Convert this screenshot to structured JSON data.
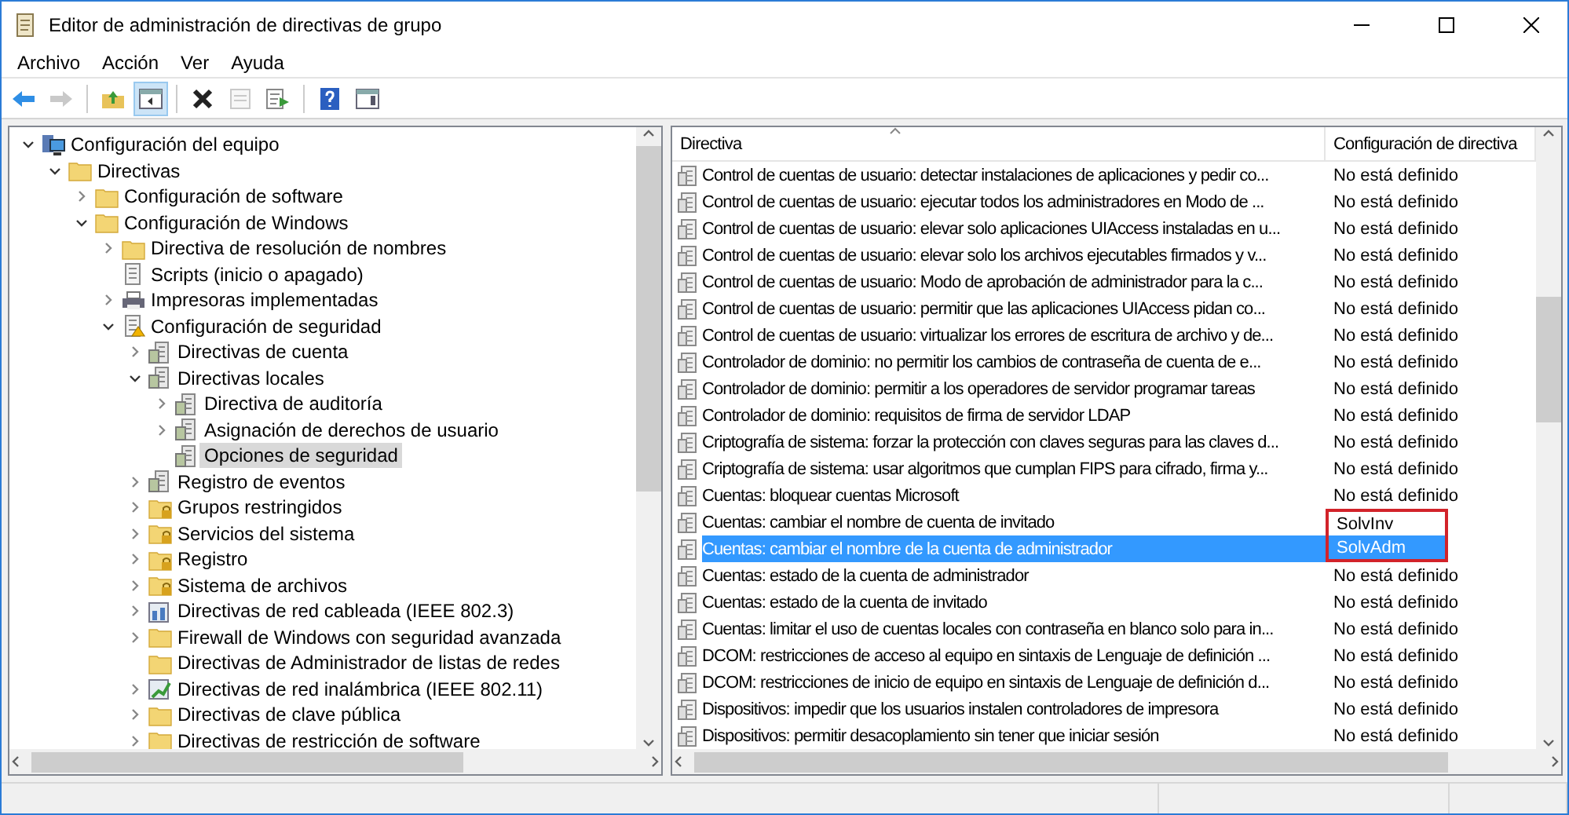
{
  "window": {
    "title": "Editor de administración de directivas de grupo"
  },
  "menu": [
    "Archivo",
    "Acción",
    "Ver",
    "Ayuda"
  ],
  "toolbar": [
    {
      "kind": "back",
      "disabled": false,
      "pressed": false
    },
    {
      "kind": "forward",
      "disabled": true,
      "pressed": false
    },
    {
      "kind": "sep"
    },
    {
      "kind": "up",
      "disabled": false,
      "pressed": false
    },
    {
      "kind": "tree",
      "disabled": false,
      "pressed": true
    },
    {
      "kind": "sep"
    },
    {
      "kind": "delete",
      "disabled": false,
      "pressed": false
    },
    {
      "kind": "properties",
      "disabled": true,
      "pressed": false
    },
    {
      "kind": "export",
      "disabled": false,
      "pressed": false
    },
    {
      "kind": "sep"
    },
    {
      "kind": "help",
      "disabled": false,
      "pressed": false
    },
    {
      "kind": "view",
      "disabled": false,
      "pressed": false
    }
  ],
  "tree": [
    {
      "label": "Configuración del equipo",
      "kind": "computer",
      "expanded": true,
      "selected": false,
      "children": [
        {
          "label": "Directivas",
          "kind": "folder",
          "expanded": true,
          "selected": false,
          "children": [
            {
              "label": "Configuración de software",
              "kind": "folder",
              "expanded": false,
              "selected": false
            },
            {
              "label": "Configuración de Windows",
              "kind": "folder",
              "expanded": true,
              "selected": false,
              "children": [
                {
                  "label": "Directiva de resolución de nombres",
                  "kind": "folder",
                  "expanded": false,
                  "selected": false
                },
                {
                  "label": "Scripts (inicio o apagado)",
                  "kind": "script",
                  "selected": false
                },
                {
                  "label": "Impresoras implementadas",
                  "kind": "printer",
                  "expanded": false,
                  "selected": false
                },
                {
                  "label": "Configuración de seguridad",
                  "kind": "security",
                  "expanded": true,
                  "selected": false,
                  "children": [
                    {
                      "label": "Directivas de cuenta",
                      "kind": "policy",
                      "expanded": false,
                      "selected": false
                    },
                    {
                      "label": "Directivas locales",
                      "kind": "policy",
                      "expanded": true,
                      "selected": false,
                      "children": [
                        {
                          "label": "Directiva de auditoría",
                          "kind": "policy",
                          "expanded": false,
                          "selected": false
                        },
                        {
                          "label": "Asignación de derechos de usuario",
                          "kind": "policy",
                          "expanded": false,
                          "selected": false
                        },
                        {
                          "label": "Opciones de seguridad",
                          "kind": "policy",
                          "selected": true
                        }
                      ]
                    },
                    {
                      "label": "Registro de eventos",
                      "kind": "policy",
                      "expanded": false,
                      "selected": false
                    },
                    {
                      "label": "Grupos restringidos",
                      "kind": "lockfolder",
                      "expanded": false,
                      "selected": false
                    },
                    {
                      "label": "Servicios del sistema",
                      "kind": "lockfolder",
                      "expanded": false,
                      "selected": false
                    },
                    {
                      "label": "Registro",
                      "kind": "lockfolder",
                      "expanded": false,
                      "selected": false
                    },
                    {
                      "label": "Sistema de archivos",
                      "kind": "lockfolder",
                      "expanded": false,
                      "selected": false
                    },
                    {
                      "label": "Directivas de red cableada (IEEE 802.3)",
                      "kind": "network",
                      "expanded": false,
                      "selected": false
                    },
                    {
                      "label": "Firewall de Windows con seguridad avanzada",
                      "kind": "folder",
                      "expanded": false,
                      "selected": false
                    },
                    {
                      "label": "Directivas de Administrador de listas de redes",
                      "kind": "folder",
                      "selected": false
                    },
                    {
                      "label": "Directivas de red inalámbrica (IEEE 802.11)",
                      "kind": "wireless",
                      "expanded": false,
                      "selected": false
                    },
                    {
                      "label": "Directivas de clave pública",
                      "kind": "folder",
                      "expanded": false,
                      "selected": false
                    },
                    {
                      "label": "Directivas de restricción de software",
                      "kind": "folder",
                      "expanded": false,
                      "selected": false
                    }
                  ]
                }
              ]
            }
          ]
        }
      ]
    }
  ],
  "table": {
    "columns": [
      "Directiva",
      "Configuración de directiva"
    ],
    "rows": [
      {
        "policy": "Control de cuentas de usuario: detectar instalaciones de aplicaciones y pedir co...",
        "setting": "No está definido",
        "selected": false,
        "highlighted": false
      },
      {
        "policy": "Control de cuentas de usuario: ejecutar todos los administradores en Modo de ...",
        "setting": "No está definido",
        "selected": false,
        "highlighted": false
      },
      {
        "policy": "Control de cuentas de usuario: elevar solo aplicaciones UIAccess instaladas en u...",
        "setting": "No está definido",
        "selected": false,
        "highlighted": false
      },
      {
        "policy": "Control de cuentas de usuario: elevar solo los archivos ejecutables firmados y v...",
        "setting": "No está definido",
        "selected": false,
        "highlighted": false
      },
      {
        "policy": "Control de cuentas de usuario: Modo de aprobación de administrador para la c...",
        "setting": "No está definido",
        "selected": false,
        "highlighted": false
      },
      {
        "policy": "Control de cuentas de usuario: permitir que las aplicaciones UIAccess pidan co...",
        "setting": "No está definido",
        "selected": false,
        "highlighted": false
      },
      {
        "policy": "Control de cuentas de usuario: virtualizar los errores de escritura de archivo y de...",
        "setting": "No está definido",
        "selected": false,
        "highlighted": false
      },
      {
        "policy": "Controlador de dominio: no permitir los cambios de contraseña de cuenta de e...",
        "setting": "No está definido",
        "selected": false,
        "highlighted": false
      },
      {
        "policy": "Controlador de dominio: permitir a los operadores de servidor programar tareas",
        "setting": "No está definido",
        "selected": false,
        "highlighted": false
      },
      {
        "policy": "Controlador de dominio: requisitos de firma de servidor LDAP",
        "setting": "No está definido",
        "selected": false,
        "highlighted": false
      },
      {
        "policy": "Criptografía de sistema: forzar la protección con claves seguras para las claves d...",
        "setting": "No está definido",
        "selected": false,
        "highlighted": false
      },
      {
        "policy": "Criptografía de sistema: usar algoritmos que cumplan FIPS para cifrado, firma y...",
        "setting": "No está definido",
        "selected": false,
        "highlighted": false
      },
      {
        "policy": "Cuentas: bloquear cuentas Microsoft",
        "setting": "No está definido",
        "selected": false,
        "highlighted": false
      },
      {
        "policy": "Cuentas: cambiar el nombre de cuenta de invitado",
        "setting": "SolvInv",
        "selected": false,
        "highlighted": true
      },
      {
        "policy": "Cuentas: cambiar el nombre de la cuenta de administrador",
        "setting": "SolvAdm",
        "selected": true,
        "highlighted": true
      },
      {
        "policy": "Cuentas: estado de la cuenta de administrador",
        "setting": "No está definido",
        "selected": false,
        "highlighted": false
      },
      {
        "policy": "Cuentas: estado de la cuenta de invitado",
        "setting": "No está definido",
        "selected": false,
        "highlighted": false
      },
      {
        "policy": "Cuentas: limitar el uso de cuentas locales con contraseña en blanco solo para in...",
        "setting": "No está definido",
        "selected": false,
        "highlighted": false
      },
      {
        "policy": "DCOM: restricciones de acceso al equipo en sintaxis de Lenguaje de definición ...",
        "setting": "No está definido",
        "selected": false,
        "highlighted": false
      },
      {
        "policy": "DCOM: restricciones de inicio de equipo en sintaxis de Lenguaje de definición d...",
        "setting": "No está definido",
        "selected": false,
        "highlighted": false
      },
      {
        "policy": "Dispositivos: impedir que los usuarios instalen controladores de impresora",
        "setting": "No está definido",
        "selected": false,
        "highlighted": false
      },
      {
        "policy": "Dispositivos: permitir desacoplamiento sin tener que iniciar sesión",
        "setting": "No está definido",
        "selected": false,
        "highlighted": false
      }
    ]
  }
}
